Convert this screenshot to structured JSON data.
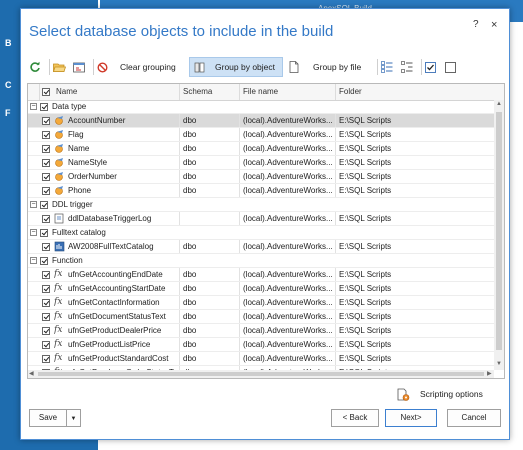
{
  "background": {
    "title": "ApexSQL Build",
    "sidebar_marks": [
      "B",
      "C",
      "F"
    ]
  },
  "dialog": {
    "title": "Select database objects to include in the build",
    "help_label": "?",
    "close_label": "×"
  },
  "toolbar": {
    "clear_grouping": "Clear grouping",
    "group_by_object": "Group by object",
    "group_by_file": "Group by file"
  },
  "grid": {
    "columns": [
      "Name",
      "Schema",
      "File name",
      "Folder"
    ],
    "rows": [
      {
        "kind": "group",
        "name": "Data type",
        "checked": true
      },
      {
        "kind": "item",
        "icon": "data-type-icon",
        "name": "AccountNumber",
        "schema": "dbo",
        "file": "(local).AdventureWorks...",
        "folder": "E:\\SQL Scripts",
        "checked": true,
        "selected": true
      },
      {
        "kind": "item",
        "icon": "data-type-icon",
        "name": "Flag",
        "schema": "dbo",
        "file": "(local).AdventureWorks...",
        "folder": "E:\\SQL Scripts",
        "checked": true
      },
      {
        "kind": "item",
        "icon": "data-type-icon",
        "name": "Name",
        "schema": "dbo",
        "file": "(local).AdventureWorks...",
        "folder": "E:\\SQL Scripts",
        "checked": true
      },
      {
        "kind": "item",
        "icon": "data-type-icon",
        "name": "NameStyle",
        "schema": "dbo",
        "file": "(local).AdventureWorks...",
        "folder": "E:\\SQL Scripts",
        "checked": true
      },
      {
        "kind": "item",
        "icon": "data-type-icon",
        "name": "OrderNumber",
        "schema": "dbo",
        "file": "(local).AdventureWorks...",
        "folder": "E:\\SQL Scripts",
        "checked": true
      },
      {
        "kind": "item",
        "icon": "data-type-icon",
        "name": "Phone",
        "schema": "dbo",
        "file": "(local).AdventureWorks...",
        "folder": "E:\\SQL Scripts",
        "checked": true
      },
      {
        "kind": "group",
        "name": "DDL trigger",
        "checked": true
      },
      {
        "kind": "item",
        "icon": "trigger-icon",
        "name": "ddlDatabaseTriggerLog",
        "schema": "",
        "file": "(local).AdventureWorks...",
        "folder": "E:\\SQL Scripts",
        "checked": true
      },
      {
        "kind": "group",
        "name": "Fulltext catalog",
        "checked": true
      },
      {
        "kind": "item",
        "icon": "catalog-icon",
        "name": "AW2008FullTextCatalog",
        "schema": "dbo",
        "file": "(local).AdventureWorks...",
        "folder": "E:\\SQL Scripts",
        "checked": true
      },
      {
        "kind": "group",
        "name": "Function",
        "checked": true
      },
      {
        "kind": "item",
        "icon": "function-icon",
        "name": "ufnGetAccountingEndDate",
        "schema": "dbo",
        "file": "(local).AdventureWorks...",
        "folder": "E:\\SQL Scripts",
        "checked": true
      },
      {
        "kind": "item",
        "icon": "function-icon",
        "name": "ufnGetAccountingStartDate",
        "schema": "dbo",
        "file": "(local).AdventureWorks...",
        "folder": "E:\\SQL Scripts",
        "checked": true
      },
      {
        "kind": "item",
        "icon": "function-icon",
        "name": "ufnGetContactInformation",
        "schema": "dbo",
        "file": "(local).AdventureWorks...",
        "folder": "E:\\SQL Scripts",
        "checked": true
      },
      {
        "kind": "item",
        "icon": "function-icon",
        "name": "ufnGetDocumentStatusText",
        "schema": "dbo",
        "file": "(local).AdventureWorks...",
        "folder": "E:\\SQL Scripts",
        "checked": true
      },
      {
        "kind": "item",
        "icon": "function-icon",
        "name": "ufnGetProductDealerPrice",
        "schema": "dbo",
        "file": "(local).AdventureWorks...",
        "folder": "E:\\SQL Scripts",
        "checked": true
      },
      {
        "kind": "item",
        "icon": "function-icon",
        "name": "ufnGetProductListPrice",
        "schema": "dbo",
        "file": "(local).AdventureWorks...",
        "folder": "E:\\SQL Scripts",
        "checked": true
      },
      {
        "kind": "item",
        "icon": "function-icon",
        "name": "ufnGetProductStandardCost",
        "schema": "dbo",
        "file": "(local).AdventureWorks...",
        "folder": "E:\\SQL Scripts",
        "checked": true
      },
      {
        "kind": "item",
        "icon": "function-icon",
        "name": "ufnGetPurchaseOrderStatusText",
        "schema": "dbo",
        "file": "(local).AdventureWorks...",
        "folder": "E:\\SQL Scripts",
        "checked": true
      }
    ]
  },
  "footer": {
    "scripting_options": "Scripting options",
    "save": "Save",
    "back": "< Back",
    "next": "Next>",
    "cancel": "Cancel"
  },
  "colors": {
    "accent": "#3479c7",
    "selected_row": "#dadada",
    "active_tool": "#cde1f5",
    "app_blue": "#1e6cae"
  }
}
